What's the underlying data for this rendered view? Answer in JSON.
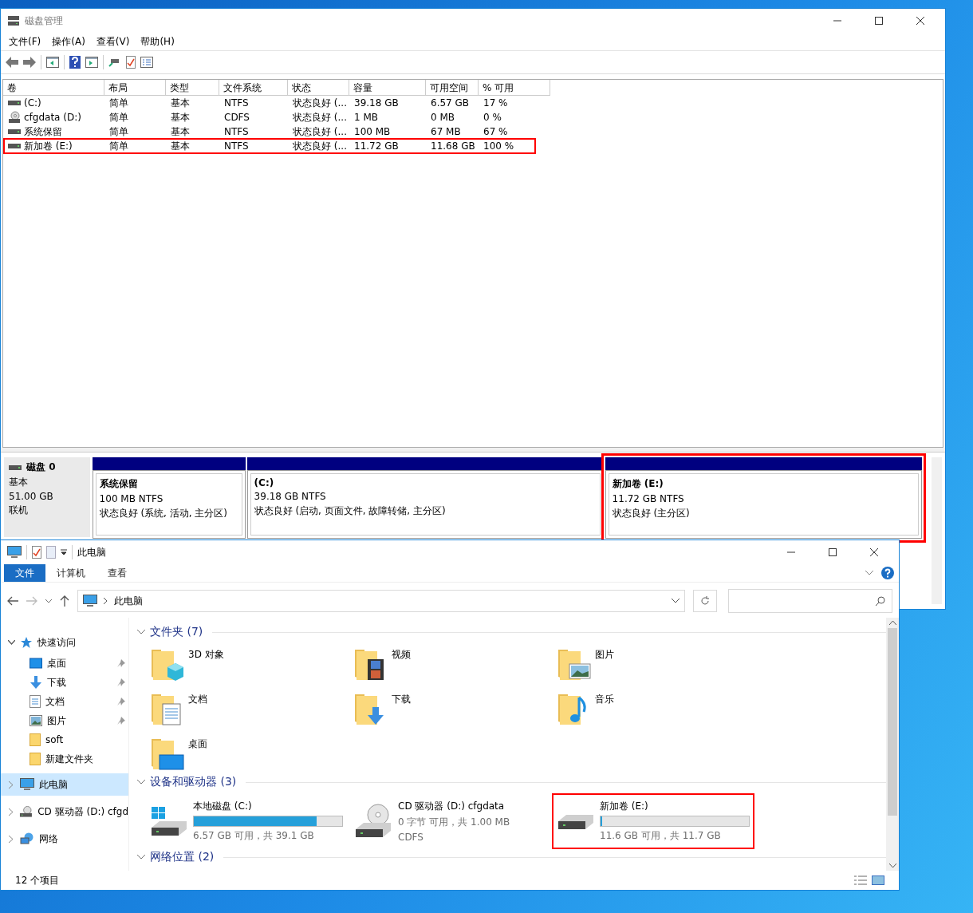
{
  "disk_window": {
    "title": "磁盘管理",
    "menu": [
      "文件(F)",
      "操作(A)",
      "查看(V)",
      "帮助(H)"
    ],
    "volumes": {
      "columns": [
        "卷",
        "布局",
        "类型",
        "文件系统",
        "状态",
        "容量",
        "可用空间",
        "% 可用"
      ],
      "rows": [
        {
          "kind": "disk",
          "highlighted": false,
          "cells": [
            "(C:)",
            "简单",
            "基本",
            "NTFS",
            "状态良好 (...",
            "39.18 GB",
            "6.57 GB",
            "17 %"
          ]
        },
        {
          "kind": "cd",
          "highlighted": false,
          "cells": [
            "cfgdata (D:)",
            "简单",
            "基本",
            "CDFS",
            "状态良好 (...",
            "1 MB",
            "0 MB",
            "0 %"
          ]
        },
        {
          "kind": "disk",
          "highlighted": false,
          "cells": [
            "系统保留",
            "简单",
            "基本",
            "NTFS",
            "状态良好 (...",
            "100 MB",
            "67 MB",
            "67 %"
          ]
        },
        {
          "kind": "disk",
          "highlighted": true,
          "cells": [
            "新加卷 (E:)",
            "简单",
            "基本",
            "NTFS",
            "状态良好 (...",
            "11.72 GB",
            "11.68 GB",
            "100 %"
          ]
        }
      ]
    },
    "disk": {
      "name": "磁盘 0",
      "type": "基本",
      "size": "51.00 GB",
      "status": "联机",
      "partitions": [
        {
          "name": "系统保留",
          "size": "100 MB NTFS",
          "status": "状态良好 (系统, 活动, 主分区)",
          "highlighted": false
        },
        {
          "name": "(C:)",
          "size": "39.18 GB NTFS",
          "status": "状态良好 (启动, 页面文件, 故障转储, 主分区)",
          "highlighted": false
        },
        {
          "name": "新加卷 (E:)",
          "size": "11.72 GB NTFS",
          "status": "状态良好 (主分区)",
          "highlighted": true
        }
      ]
    }
  },
  "explorer": {
    "title": "此电脑",
    "ribbon_tabs": [
      {
        "label": "文件",
        "selected": true
      },
      {
        "label": "计算机",
        "selected": false
      },
      {
        "label": "查看",
        "selected": false
      }
    ],
    "address": "此电脑",
    "nav": [
      {
        "label": "快速访问",
        "kind": "quick",
        "expanded": true,
        "selected": false,
        "children": [
          {
            "label": "桌面",
            "kind": "desktop",
            "pinned": true
          },
          {
            "label": "下载",
            "kind": "downloads",
            "pinned": true
          },
          {
            "label": "文档",
            "kind": "documents",
            "pinned": true
          },
          {
            "label": "图片",
            "kind": "pictures",
            "pinned": true
          },
          {
            "label": "soft",
            "kind": "folder",
            "pinned": false
          },
          {
            "label": "新建文件夹",
            "kind": "folder",
            "pinned": false
          }
        ]
      },
      {
        "label": "此电脑",
        "kind": "pc",
        "expanded": false,
        "selected": true
      },
      {
        "label": "CD 驱动器 (D:) cfgd",
        "kind": "cd",
        "expanded": false,
        "selected": false
      },
      {
        "label": "网络",
        "kind": "network",
        "expanded": false,
        "selected": false
      }
    ],
    "groups": [
      {
        "title": "文件夹 (7)",
        "folders": [
          {
            "label": "3D 对象",
            "kind": "objects"
          },
          {
            "label": "视频",
            "kind": "videos"
          },
          {
            "label": "图片",
            "kind": "pictures"
          },
          {
            "label": "文档",
            "kind": "documents"
          },
          {
            "label": "下载",
            "kind": "downloads"
          },
          {
            "label": "音乐",
            "kind": "music"
          },
          {
            "label": "桌面",
            "kind": "desktop"
          }
        ]
      },
      {
        "title": "设备和驱动器 (3)",
        "drives": [
          {
            "name": "本地磁盘 (C:)",
            "kind": "system",
            "level": 0.83,
            "caption": "6.57 GB 可用，共 39.1 GB",
            "highlighted": false
          },
          {
            "name": "CD 驱动器 (D:) cfgdata",
            "kind": "cd",
            "lines": [
              "0 字节 可用，共 1.00 MB",
              "CDFS"
            ],
            "highlighted": false
          },
          {
            "name": "新加卷 (E:)",
            "kind": "disk",
            "level": 0.01,
            "caption": "11.6 GB 可用，共 11.7 GB",
            "highlighted": true
          }
        ]
      },
      {
        "title": "网络位置 (2)"
      }
    ],
    "status": "12 个项目"
  }
}
